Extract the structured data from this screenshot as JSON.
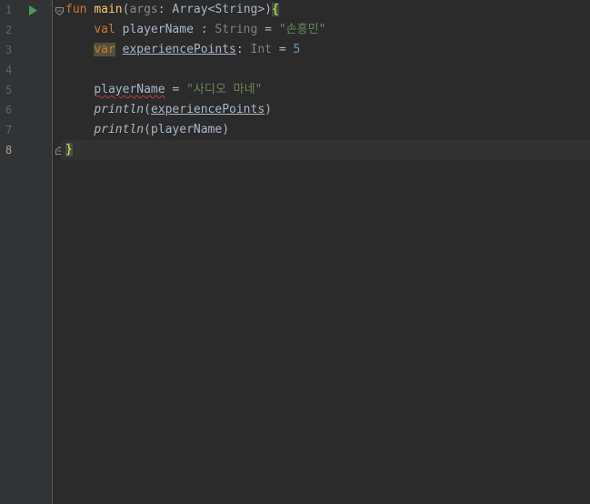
{
  "editor": {
    "line_numbers": [
      "1",
      "2",
      "3",
      "4",
      "5",
      "6",
      "7",
      "8"
    ],
    "current_line": "8",
    "icons": {
      "run": "run-gutter-icon",
      "fold": "fold-marker-icon"
    },
    "colors": {
      "background": "#2b2b2b",
      "gutter": "#313335",
      "keyword": "#cc7832",
      "function": "#ffc66d",
      "string": "#6a8759",
      "number": "#6897bb",
      "error_squiggle": "#bc3f3c"
    },
    "code": {
      "line1": {
        "kw_fun": "fun",
        "fn_name": "main",
        "paren_open": "(",
        "param": "args",
        "colon": ": ",
        "type": "Array<String>",
        "paren_close": ")",
        "brace_open": "{"
      },
      "line2": {
        "indent": "    ",
        "kw_val": "val",
        "name": " playerName",
        "colon": " : ",
        "type": "String",
        "eq": " = ",
        "value": "\"손흥민\""
      },
      "line3": {
        "indent": "    ",
        "kw_var": "var",
        "space": " ",
        "name": "experiencePoints",
        "colon": ": ",
        "type": "Int",
        "eq": " = ",
        "value": "5"
      },
      "line5": {
        "indent": "    ",
        "name": "playerName",
        "eq": " = ",
        "value": "\"사디오 마네\""
      },
      "line6": {
        "indent": "    ",
        "fn": "println",
        "paren_open": "(",
        "arg": "experiencePoints",
        "paren_close": ")"
      },
      "line7": {
        "indent": "    ",
        "fn": "println",
        "paren_open": "(",
        "arg": "playerName",
        "paren_close": ")"
      },
      "line8": {
        "brace_close": "}"
      }
    }
  }
}
